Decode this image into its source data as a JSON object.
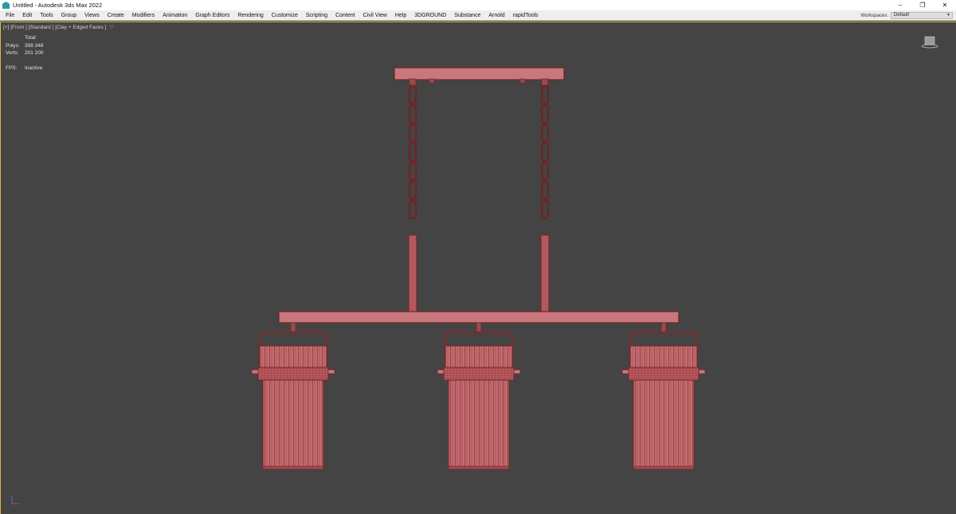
{
  "window": {
    "title": "Untitled - Autodesk 3ds Max 2022",
    "minimize_glyph": "–",
    "restore_glyph": "❐",
    "close_glyph": "✕"
  },
  "menu": {
    "items": [
      "File",
      "Edit",
      "Tools",
      "Group",
      "Views",
      "Create",
      "Modifiers",
      "Animation",
      "Graph Editors",
      "Rendering",
      "Customize",
      "Scripting",
      "Content",
      "Civil View",
      "Help",
      "3DGROUND",
      "Substance",
      "Arnold",
      "rapidTools"
    ],
    "workspaces_label": "Workspaces:",
    "workspaces_value": "Default"
  },
  "viewport": {
    "label": "[+] [Front ] [Standard ] [Clay + Edged Faces ]",
    "filter_icon": "funnel-icon",
    "stats": {
      "header": "Total",
      "polys_label": "Polys:",
      "polys_value": "398 348",
      "verts_label": "Verts:",
      "verts_value": "201 200",
      "fps_label": "FPS:",
      "fps_value": "Inactive"
    },
    "object_color": "#c8777c",
    "wire_color": "#7a2d2d",
    "background": "#444444",
    "active_border": "#d9b84a"
  }
}
